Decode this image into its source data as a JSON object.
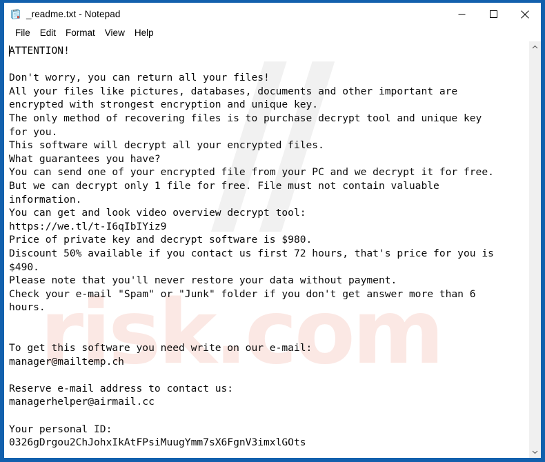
{
  "window": {
    "title": "_readme.txt - Notepad",
    "icon": "notepad-icon",
    "controls": {
      "minimize_label": "—",
      "maximize_label": "☐",
      "close_label": "✕"
    },
    "frame_color": "#1260ad"
  },
  "menubar": {
    "items": [
      {
        "label": "File"
      },
      {
        "label": "Edit"
      },
      {
        "label": "Format"
      },
      {
        "label": "View"
      },
      {
        "label": "Help"
      }
    ]
  },
  "scrollbar": {
    "up_arrow": "˄",
    "down_arrow": "˅"
  },
  "watermark": {
    "text": "risk.com",
    "color": "#fbe7e3"
  },
  "document": {
    "filename": "_readme.txt",
    "body": "ATTENTION!\n\nDon't worry, you can return all your files!\nAll your files like pictures, databases, documents and other important are\nencrypted with strongest encryption and unique key.\nThe only method of recovering files is to purchase decrypt tool and unique key\nfor you.\nThis software will decrypt all your encrypted files.\nWhat guarantees you have?\nYou can send one of your encrypted file from your PC and we decrypt it for free.\nBut we can decrypt only 1 file for free. File must not contain valuable\ninformation.\nYou can get and look video overview decrypt tool:\nhttps://we.tl/t-I6qIbIYiz9\nPrice of private key and decrypt software is $980.\nDiscount 50% available if you contact us first 72 hours, that's price for you is\n$490.\nPlease note that you'll never restore your data without payment.\nCheck your e-mail \"Spam\" or \"Junk\" folder if you don't get answer more than 6\nhours.\n\n\nTo get this software you need write on our e-mail:\nmanager@mailtemp.ch\n\nReserve e-mail address to contact us:\nmanagerhelper@airmail.cc\n\nYour personal ID:\n0326gDrgou2ChJohxIkAtFPsiMuugYmm7sX6FgnV3imxlGOts",
    "details": {
      "heading": "ATTENTION!",
      "video_url": "https://we.tl/t-I6qIbIYiz9",
      "price": "$980",
      "discount_price": "$490",
      "discount_percent": "50%",
      "discount_window_hours": "72 hours",
      "answer_wait_hours": "6",
      "free_decrypt_file_count": "1",
      "primary_email": "manager@mailtemp.ch",
      "reserve_email": "managerhelper@airmail.cc",
      "personal_id": "0326gDrgou2ChJohxIkAtFPsiMuugYmm7sX6FgnV3imxlGOts"
    }
  }
}
